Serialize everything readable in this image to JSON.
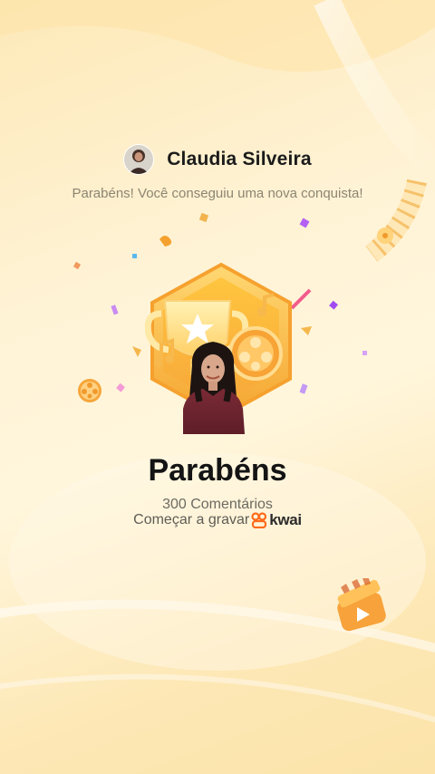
{
  "header": {
    "user_name": "Claudia Silveira",
    "avatar_icon": "user-avatar"
  },
  "subtitle": "Parabéns! Você conseguiu uma nova conquista!",
  "badge": {
    "icons": [
      "trophy-icon",
      "star-icon",
      "film-reel-icon",
      "music-note-icon"
    ],
    "colors": {
      "gold": "#f7b936",
      "gold_light": "#ffd873",
      "orange": "#f09a2c"
    }
  },
  "main": {
    "title": "Parabéns",
    "achievement": "300 Comentários",
    "cta_text": "Começar a gravar",
    "brand": "kwai"
  },
  "colors": {
    "brand_orange": "#ff6a1a",
    "background": "#fff3d6"
  }
}
